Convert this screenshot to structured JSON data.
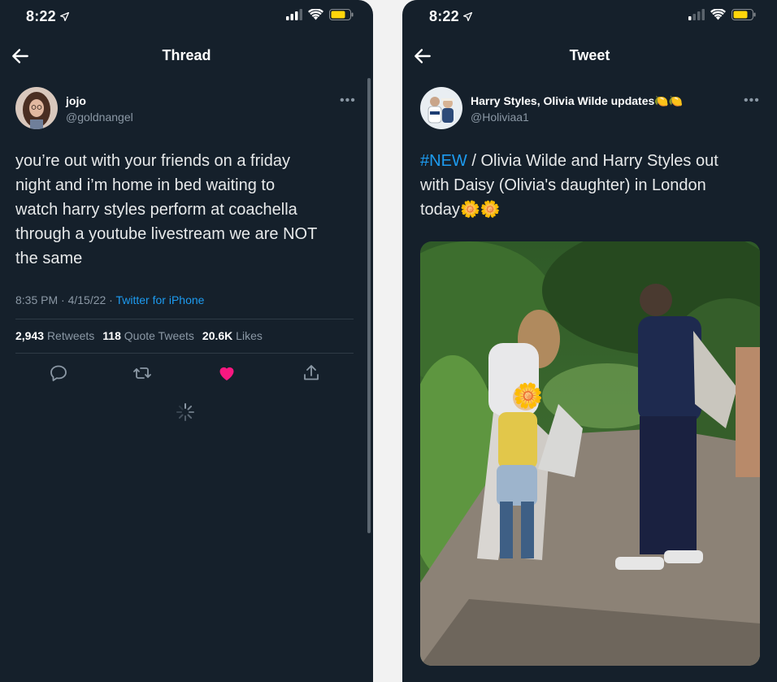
{
  "colors": {
    "background": "#15202b",
    "text": "#e7e9ea",
    "secondary_text": "#8b98a5",
    "accent_blue": "#1d9bf0",
    "like_pink": "#f91880",
    "divider": "#2f3b46"
  },
  "left_screen": {
    "status_bar": {
      "time": "8:22"
    },
    "nav": {
      "title": "Thread",
      "back_icon": "arrow-left-icon"
    },
    "tweet": {
      "author_name": "jojo",
      "author_handle": "@goldnangel",
      "text_lines": [
        "you’re out with your friends on a friday",
        "night and i’m home in bed waiting to",
        "watch harry styles perform at coachella",
        "through a youtube livestream we are NOT",
        "the same"
      ],
      "timestamp": "8:35 PM · 4/15/22 · ",
      "source": "Twitter for iPhone",
      "retweets_count": "2,943",
      "retweets_label": "Retweets",
      "quotes_count": "118",
      "quotes_label": "Quote Tweets",
      "likes_count": "20.6K",
      "likes_label": "Likes",
      "liked": true
    },
    "actions": [
      "reply-icon",
      "retweet-icon",
      "like-icon",
      "share-icon"
    ]
  },
  "right_screen": {
    "status_bar": {
      "time": "8:22"
    },
    "nav": {
      "title": "Tweet",
      "back_icon": "arrow-left-icon"
    },
    "tweet": {
      "author_name": "Harry Styles, Olivia Wilde updates",
      "author_name_emoji": "🍋🍋",
      "author_handle": "@Holiviaa1",
      "hashtag": "#NEW",
      "text_line1_rest": " / Olivia Wilde and Harry Styles out",
      "text_line2": "with Daisy (Olivia's daughter) in London",
      "text_line3": "today",
      "text_line3_emoji": "🌼🌼",
      "media_overlay_emoji": "🌼"
    }
  }
}
